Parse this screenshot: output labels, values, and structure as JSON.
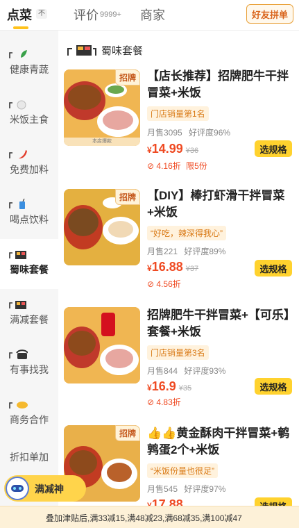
{
  "tabs": {
    "order": "点菜",
    "order_badge": "不",
    "reviews": "评价",
    "reviews_count": "9999+",
    "merchant": "商家",
    "friend_btn": "好友拼单"
  },
  "sidebar": {
    "items": [
      {
        "label": "健康青蔬",
        "icon": "leaf-icon"
      },
      {
        "label": "米饭主食",
        "icon": "rice-bowl-icon"
      },
      {
        "label": "免费加料",
        "icon": "chili-icon"
      },
      {
        "label": "喝点饮料",
        "icon": "drink-icon"
      },
      {
        "label": "蜀味套餐",
        "icon": "bento-icon"
      },
      {
        "label": "满减套餐",
        "icon": "bento-icon"
      },
      {
        "label": "有事找我",
        "icon": "phone-icon"
      },
      {
        "label": "商务合作",
        "icon": "handshake-icon"
      },
      {
        "label": "折扣单加",
        "icon": ""
      }
    ]
  },
  "category": {
    "title": "蜀味套餐",
    "icon": "bento-icon"
  },
  "products": [
    {
      "tag": "招牌",
      "strip": "本店爆款",
      "name": "【店长推荐】招牌肥牛干拌冒菜+米饭",
      "pill": "门店销量第1名",
      "sales": "月售3095",
      "rating": "好评度96%",
      "cur": "¥",
      "price": "14.99",
      "old": "¥36",
      "discount": "4.16折",
      "limit": "限5份",
      "btn": "选规格"
    },
    {
      "tag": "招牌",
      "name": "【DIY】棒打虾滑干拌冒菜+米饭",
      "pill": "“好吃，辣深得我心”",
      "sales": "月售221",
      "rating": "好评度89%",
      "cur": "¥",
      "price": "16.88",
      "old": "¥37",
      "discount": "4.56折",
      "btn": "选规格"
    },
    {
      "name": "招牌肥牛干拌冒菜+【可乐】套餐+米饭",
      "pill": "门店销量第3名",
      "sales": "月售844",
      "rating": "好评度93%",
      "cur": "¥",
      "price": "16.9",
      "old": "¥35",
      "discount": "4.83折",
      "btn": "选规格"
    },
    {
      "tag": "招牌",
      "name": "👍👍黄金酥肉干拌冒菜+鹌鹑蛋2个+米饭",
      "pill": "“米饭份量也很足”",
      "sales": "月售545",
      "rating": "好评度97%",
      "cur": "¥",
      "price": "17.88",
      "btn": "选规格"
    }
  ],
  "promo": {
    "mascot": "满减神",
    "text": "叠加津贴后,满33减15,满48减23,满68减35,满100减47"
  },
  "colors": {
    "accent": "#ffd22e",
    "price": "#ef4a22",
    "pill_text": "#d97a16"
  }
}
